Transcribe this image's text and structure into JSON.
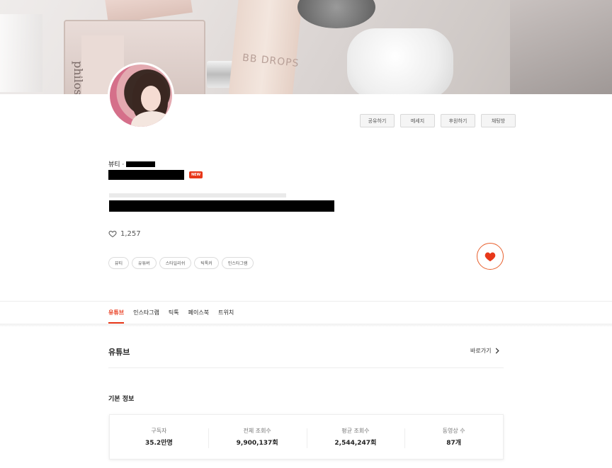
{
  "profile": {
    "category": "뷰티 ·",
    "new_badge": "NEW",
    "likes": "1,257",
    "actions": [
      "공유하기",
      "메세지",
      "후원하기",
      "채팅방"
    ],
    "tags": [
      "뷰티",
      "유튜버",
      "스타일리쉬",
      "틱톡커",
      "인스타그램"
    ]
  },
  "tabs": [
    "유튜브",
    "인스타그램",
    "틱톡",
    "페이스북",
    "트위치"
  ],
  "youtube": {
    "title": "유튜브",
    "goto_label": "바로가기",
    "basic_info_title": "기본 정보",
    "stats": [
      {
        "label": "구독자",
        "value": "35.2만명"
      },
      {
        "label": "전체 조회수",
        "value": "9,900,137회"
      },
      {
        "label": "평균 조회수",
        "value": "2,544,247회"
      },
      {
        "label": "동영상 수",
        "value": "87개"
      }
    ]
  },
  "cover": {
    "bottle_text": "philosophy",
    "tube_text": "BB DROPS"
  },
  "colors": {
    "accent": "#e8381a",
    "heart": "#e8381a"
  }
}
